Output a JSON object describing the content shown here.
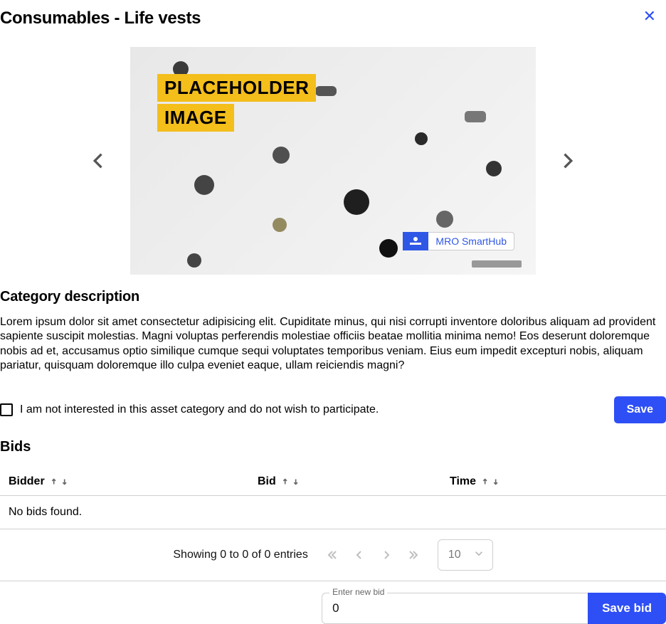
{
  "header": {
    "title": "Consumables - Life vests"
  },
  "carousel": {
    "image_overlay": {
      "line1": "PLACEHOLDER",
      "line2": "IMAGE"
    },
    "brand_text": "MRO SmartHub"
  },
  "category": {
    "heading": "Category description",
    "body": "Lorem ipsum dolor sit amet consectetur adipisicing elit. Cupiditate minus, qui nisi corrupti inventore doloribus aliquam ad provident sapiente suscipit molestias. Magni voluptas perferendis molestiae officiis beatae mollitia minima nemo! Eos deserunt doloremque nobis ad et, accusamus optio similique cumque sequi voluptates temporibus veniam. Eius eum impedit excepturi nobis, aliquam pariatur, quisquam doloremque illo culpa eveniet eaque, ullam reiciendis magni?"
  },
  "optout": {
    "label": "I am not interested in this asset category and do not wish to participate.",
    "save_label": "Save"
  },
  "bids": {
    "heading": "Bids",
    "columns": {
      "bidder": "Bidder",
      "bid": "Bid",
      "time": "Time"
    },
    "empty": "No bids found."
  },
  "pagination": {
    "text": "Showing 0 to 0 of 0 entries",
    "page_size": "10"
  },
  "new_bid": {
    "legend": "Enter new bid",
    "value": "0",
    "save_label": "Save bid"
  }
}
